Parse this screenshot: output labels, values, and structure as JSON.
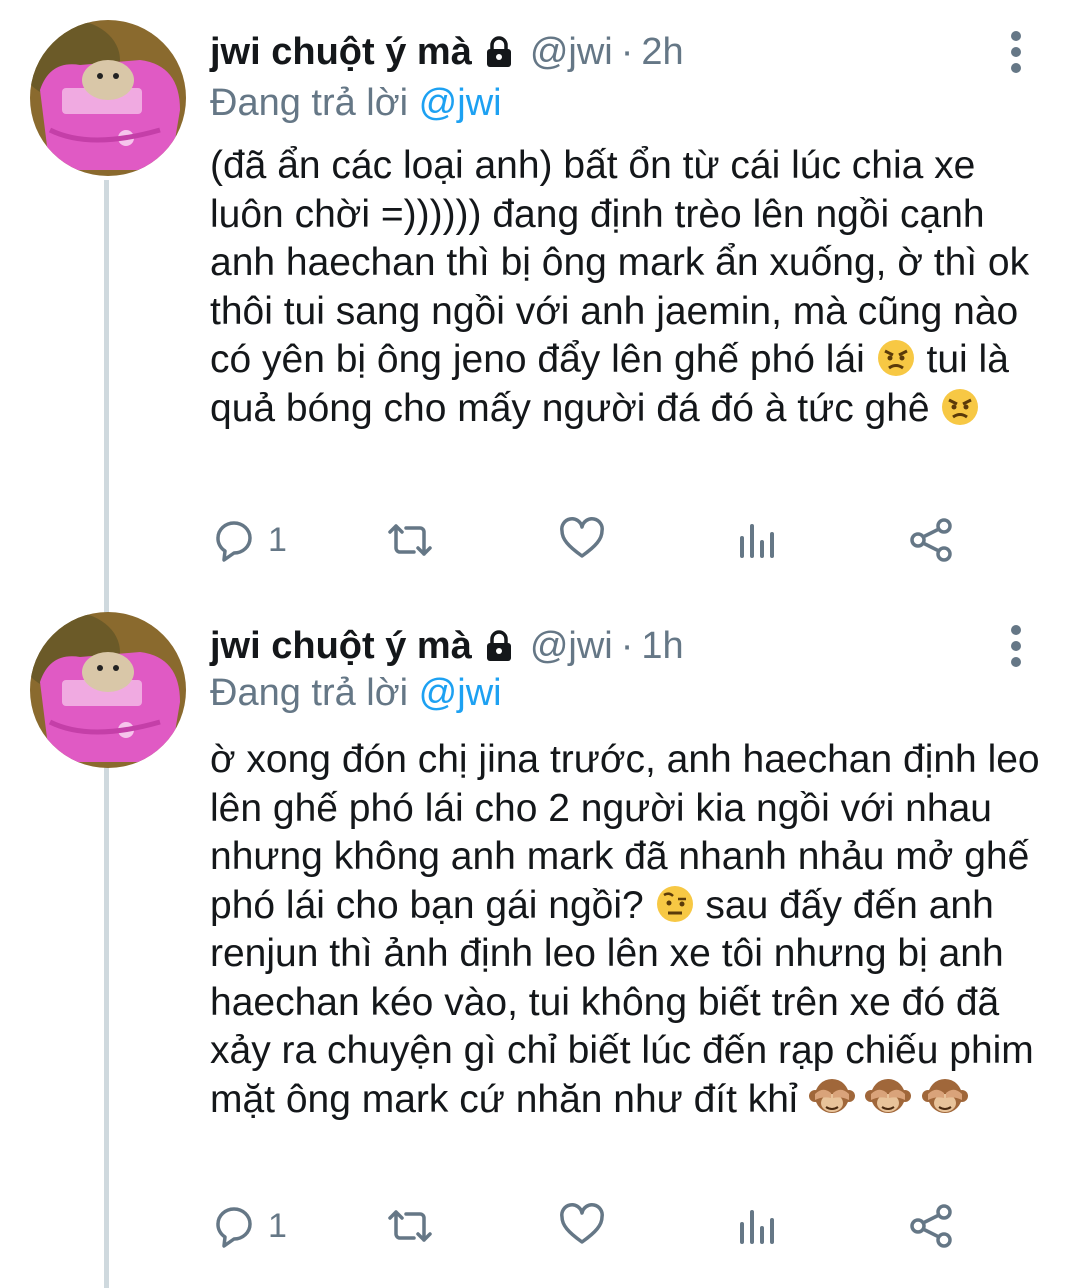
{
  "tweets": [
    {
      "name": "jwi chuột ý mà",
      "handle": "@jwi",
      "separator": "·",
      "time": "2h",
      "replying_prefix": "Đang trả lời",
      "replying_to": "@jwi",
      "text_parts": [
        "(đã ẩn các loại anh) bất ổn từ cái lúc chia xe luôn chời =)))))) đang định trèo lên ngồi cạnh anh haechan thì bị ông mark ẩn xuống, ờ thì ok thôi tui sang ngồi với anh jaemin, mà cũng nào có yên bị ông jeno đẩy lên ghế phó lái",
        "tui là quả bóng cho mấy người đá đó à tức ghê"
      ],
      "emojis": [
        "angry-face",
        "angry-face"
      ],
      "reply_count": "1"
    },
    {
      "name": "jwi chuột ý mà",
      "handle": "@jwi",
      "separator": "·",
      "time": "1h",
      "replying_prefix": "Đang trả lời",
      "replying_to": "@jwi",
      "text_parts": [
        "ờ xong đón chị jina trước, anh haechan định leo lên ghế phó lái cho 2 người kia ngồi với nhau nhưng không anh mark đã nhanh nhảu mở ghế phó lái cho bạn gái ngồi?",
        "sau đấy đến anh renjun thì ảnh định leo lên xe tôi nhưng bị anh haechan kéo vào, tui không biết trên xe đó đã xảy ra chuyện gì chỉ biết lúc đến rạp chiếu phim mặt ông mark cứ nhăn như đít khỉ"
      ],
      "emojis": [
        "face-with-raised-eyebrow",
        "see-no-evil-monkey",
        "see-no-evil-monkey",
        "see-no-evil-monkey"
      ],
      "reply_count": "1"
    }
  ],
  "colors": {
    "text": "#14171a",
    "secondary": "#657786",
    "accent": "#1da1f2",
    "thread_line": "#cfd9de"
  },
  "icons": [
    "lock-icon",
    "more-options-icon",
    "reply-icon",
    "retweet-icon",
    "like-icon",
    "analytics-icon",
    "share-icon"
  ]
}
